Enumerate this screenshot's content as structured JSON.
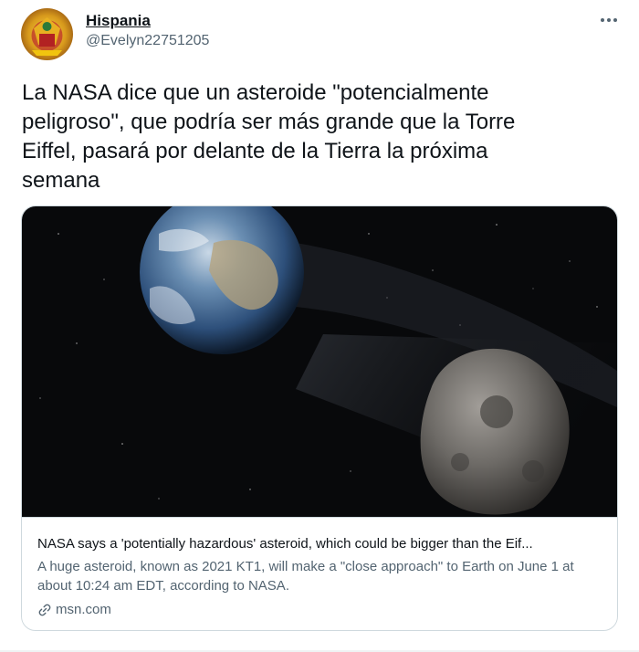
{
  "tweet": {
    "author": {
      "name": "Hispania",
      "handle": "@Evelyn22751205"
    },
    "more_icon": "ellipsis-icon",
    "text": "La NASA dice que un asteroide \"potencialmente\npeligroso\", que podría ser más grande que la Torre\nEiffel, pasará por delante de la Tierra la próxima\nsemana",
    "card": {
      "title": "NASA says a 'potentially hazardous' asteroid, which could be bigger than the Eif...",
      "description": "A huge asteroid, known as 2021 KT1, will make a \"close approach\" to Earth on June 1 at about 10:24 am EDT, according to NASA.",
      "domain": "msn.com",
      "domain_icon": "link-icon"
    }
  },
  "colors": {
    "text_primary": "#0f1419",
    "text_secondary": "#536471",
    "border": "#cfd9de"
  }
}
